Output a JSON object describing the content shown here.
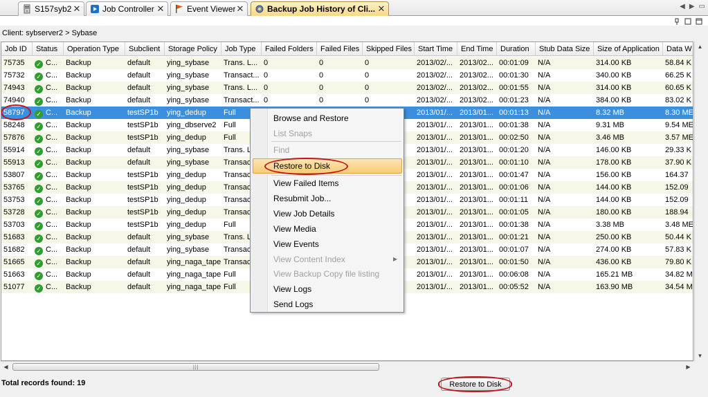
{
  "tabs": [
    {
      "label": "S157syb2",
      "icon": "server-icon"
    },
    {
      "label": "Job Controller",
      "icon": "job-controller-icon"
    },
    {
      "label": "Event Viewer",
      "icon": "flag-icon"
    },
    {
      "label": "Backup Job History of Cli...",
      "icon": "gear-icon"
    }
  ],
  "client_path": "Client: sybserver2 > Sybase",
  "columns": [
    "Job ID",
    "Status",
    "Operation Type",
    "Subclient",
    "Storage Policy",
    "Job Type",
    "Failed Folders",
    "Failed Files",
    "Skipped Files",
    "Start Time",
    "End Time",
    "Duration",
    "Stub Data Size",
    "Size of Application",
    "Data W"
  ],
  "rows": [
    [
      "75735",
      "C...",
      "Backup",
      "default",
      "ying_sybase",
      "Trans. L...",
      "0",
      "0",
      "0",
      "2013/02/...",
      "2013/02...",
      "00:01:09",
      "N/A",
      "314.00 KB",
      "58.84 K"
    ],
    [
      "75732",
      "C...",
      "Backup",
      "default",
      "ying_sybase",
      "Transact...",
      "0",
      "0",
      "0",
      "2013/02/...",
      "2013/02...",
      "00:01:30",
      "N/A",
      "340.00 KB",
      "66.25 K"
    ],
    [
      "74943",
      "C...",
      "Backup",
      "default",
      "ying_sybase",
      "Trans. L...",
      "0",
      "0",
      "0",
      "2013/02/...",
      "2013/02...",
      "00:01:55",
      "N/A",
      "314.00 KB",
      "60.65 K"
    ],
    [
      "74940",
      "C...",
      "Backup",
      "default",
      "ying_sybase",
      "Transact...",
      "0",
      "0",
      "0",
      "2013/02/...",
      "2013/02...",
      "00:01:23",
      "N/A",
      "384.00 KB",
      "83.02 K"
    ],
    [
      "58797",
      "C...",
      "Backup",
      "testSP1b",
      "ying_dedup",
      "Full",
      "",
      "",
      "",
      "2013/01/...",
      "2013/01...",
      "00:01:13",
      "N/A",
      "8.32 MB",
      "8.30 ME"
    ],
    [
      "58248",
      "C...",
      "Backup",
      "testSP1b",
      "ying_dbserve2",
      "Full",
      "",
      "",
      "",
      "2013/01/...",
      "2013/01...",
      "00:01:38",
      "N/A",
      "9.31 MB",
      "9.54 ME"
    ],
    [
      "57876",
      "C...",
      "Backup",
      "testSP1b",
      "ying_dedup",
      "Full",
      "",
      "",
      "",
      "2013/01/...",
      "2013/01...",
      "00:02:50",
      "N/A",
      "3.46 MB",
      "3.57 ME"
    ],
    [
      "55914",
      "C...",
      "Backup",
      "default",
      "ying_sybase",
      "Trans. L",
      "",
      "",
      "",
      "2013/01/...",
      "2013/01...",
      "00:01:20",
      "N/A",
      "146.00 KB",
      "29.33 K"
    ],
    [
      "55913",
      "C...",
      "Backup",
      "default",
      "ying_sybase",
      "Transact",
      "",
      "",
      "",
      "2013/01/...",
      "2013/01...",
      "00:01:10",
      "N/A",
      "178.00 KB",
      "37.90 K"
    ],
    [
      "53807",
      "C...",
      "Backup",
      "testSP1b",
      "ying_dedup",
      "Transact",
      "",
      "",
      "",
      "2013/01/...",
      "2013/01...",
      "00:01:47",
      "N/A",
      "156.00 KB",
      "164.37"
    ],
    [
      "53765",
      "C...",
      "Backup",
      "testSP1b",
      "ying_dedup",
      "Transact",
      "",
      "",
      "",
      "2013/01/...",
      "2013/01...",
      "00:01:06",
      "N/A",
      "144.00 KB",
      "152.09"
    ],
    [
      "53753",
      "C...",
      "Backup",
      "testSP1b",
      "ying_dedup",
      "Transact",
      "",
      "",
      "",
      "2013/01/...",
      "2013/01...",
      "00:01:11",
      "N/A",
      "144.00 KB",
      "152.09"
    ],
    [
      "53728",
      "C...",
      "Backup",
      "testSP1b",
      "ying_dedup",
      "Transact",
      "",
      "",
      "",
      "2013/01/...",
      "2013/01...",
      "00:01:05",
      "N/A",
      "180.00 KB",
      "188.94"
    ],
    [
      "53703",
      "C...",
      "Backup",
      "testSP1b",
      "ying_dedup",
      "Full",
      "",
      "",
      "",
      "2013/01/...",
      "2013/01...",
      "00:01:38",
      "N/A",
      "3.38 MB",
      "3.48 ME"
    ],
    [
      "51683",
      "C...",
      "Backup",
      "default",
      "ying_sybase",
      "Trans. L",
      "",
      "",
      "",
      "2013/01/...",
      "2013/01...",
      "00:01:21",
      "N/A",
      "250.00 KB",
      "50.44 K"
    ],
    [
      "51682",
      "C...",
      "Backup",
      "default",
      "ying_sybase",
      "Transact",
      "",
      "",
      "",
      "2013/01/...",
      "2013/01...",
      "00:01:07",
      "N/A",
      "274.00 KB",
      "57.83 K"
    ],
    [
      "51665",
      "C...",
      "Backup",
      "default",
      "ying_naga_tape",
      "Transact",
      "",
      "",
      "",
      "2013/01/...",
      "2013/01...",
      "00:01:50",
      "N/A",
      "436.00 KB",
      "79.80 K"
    ],
    [
      "51663",
      "C...",
      "Backup",
      "default",
      "ying_naga_tape",
      "Full",
      "",
      "",
      "",
      "2013/01/...",
      "2013/01...",
      "00:06:08",
      "N/A",
      "165.21 MB",
      "34.82 M"
    ],
    [
      "51077",
      "C...",
      "Backup",
      "default",
      "ying_naga_tape",
      "Full",
      "",
      "",
      "",
      "2013/01/...",
      "2013/01...",
      "00:05:52",
      "N/A",
      "163.90 MB",
      "34.54 M"
    ]
  ],
  "selected_row_index": 4,
  "context_menu": {
    "items": [
      {
        "label": "Browse and Restore",
        "enabled": true
      },
      {
        "label": "List Snaps",
        "enabled": false
      },
      {
        "label": "Find",
        "enabled": false
      },
      {
        "label": "Restore to Disk",
        "enabled": true,
        "highlighted": true
      },
      {
        "label": "View Failed Items",
        "enabled": true
      },
      {
        "label": "Resubmit Job...",
        "enabled": true
      },
      {
        "label": "View Job Details",
        "enabled": true
      },
      {
        "label": "View Media",
        "enabled": true
      },
      {
        "label": "View Events",
        "enabled": true
      },
      {
        "label": "View Content Index",
        "enabled": false,
        "submenu": true
      },
      {
        "label": "View Backup Copy file listing",
        "enabled": false
      },
      {
        "label": "View Logs",
        "enabled": true
      },
      {
        "label": "Send Logs",
        "enabled": true
      }
    ]
  },
  "footer": {
    "total_label": "Total records found: 19",
    "restore_button_label": "Restore to Disk"
  },
  "colors": {
    "selection": "#3b8fdc",
    "alt_row": "#f7f7e8",
    "annotation_red": "#c0131d",
    "active_tab": "#f8d883",
    "success_green": "#2f9d2f"
  }
}
